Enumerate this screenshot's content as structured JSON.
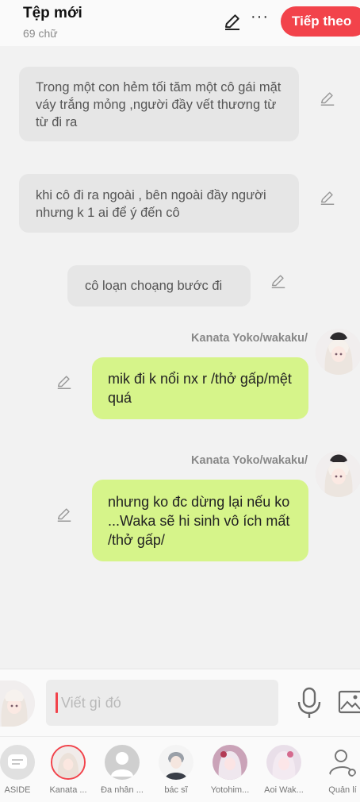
{
  "header": {
    "title": "Tệp mới",
    "word_count": "69 chữ",
    "next_label": "Tiếp theo",
    "more_label": "···"
  },
  "messages": [
    {
      "kind": "narration",
      "text": "Trong một con hẻm tối tăm một cô gái mặt váy trắng mỏng ,người đầy vết thương từ từ đi ra"
    },
    {
      "kind": "narration",
      "text": "khi cô đi ra ngoài , bên ngoài đầy người nhưng k 1 ai để ý đến cô"
    },
    {
      "kind": "narration",
      "text": "cô loạn choạng bước đi"
    },
    {
      "kind": "speech",
      "speaker": "Kanata Yoko/wakaku/",
      "text": "mik đi k nổi nx r /thở gấp/mệt quá"
    },
    {
      "kind": "speech",
      "speaker": "Kanata Yoko/wakaku/",
      "text": "nhưng ko đc dừng lại nếu ko ...Waka sẽ hi sinh vô ích mất /thở gấp/"
    }
  ],
  "input": {
    "placeholder": "Viết gì đó"
  },
  "characters": [
    {
      "name": "ASIDE",
      "icon": "chat-bubble-icon"
    },
    {
      "name": "Kanata ...",
      "icon": "anime-girl-avatar"
    },
    {
      "name": "Đa nhân ...",
      "icon": "person-silhouette-icon"
    },
    {
      "name": "bác sĩ",
      "icon": "anime-boy-avatar"
    },
    {
      "name": "Yotohim...",
      "icon": "anime-girl-avatar"
    },
    {
      "name": "Aoi Wak...",
      "icon": "anime-girl-avatar"
    },
    {
      "name": "Quản lí",
      "icon": "user-settings-icon"
    }
  ],
  "colors": {
    "accent": "#f2434b",
    "bubble": "#d6f48a",
    "narration_bg": "#e6e6e6",
    "background": "#f2f2f2"
  }
}
